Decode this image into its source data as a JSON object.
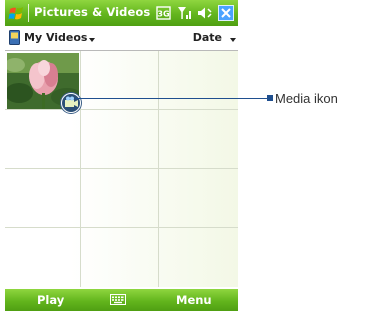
{
  "titlebar": {
    "title": "Pictures & Videos"
  },
  "subheader": {
    "folder_label": "My Videos",
    "sort_label": "Date"
  },
  "softkeys": {
    "left": "Play",
    "right": "Menu"
  },
  "callout": {
    "label": "Media ikon"
  },
  "icons": {
    "start": "windows-flag-icon",
    "status": [
      "data-connection-icon",
      "signal-strength-icon",
      "volume-icon",
      "close-icon"
    ],
    "folder": "phone-storage-icon",
    "input": "keyboard-icon",
    "media": "video-clip-icon"
  },
  "colors": {
    "bar_green": "#63b51d",
    "callout": "#1f4f8f",
    "close_box": "#4aa3ff"
  }
}
